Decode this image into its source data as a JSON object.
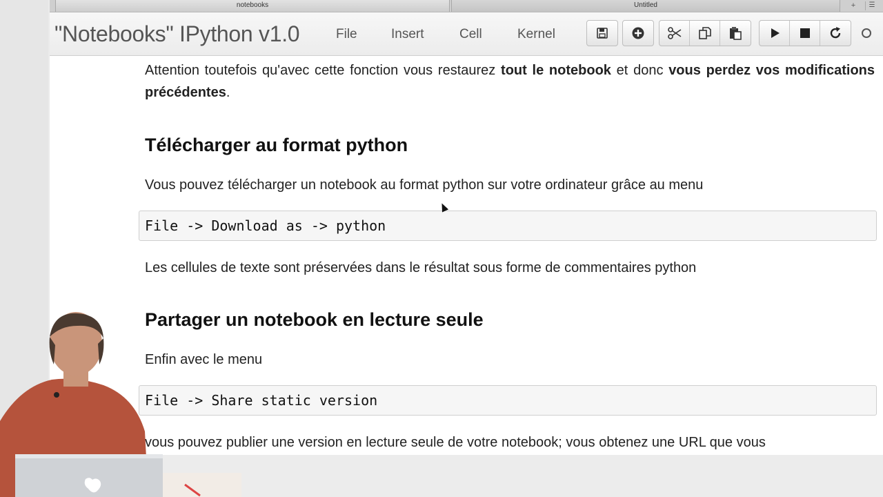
{
  "browser": {
    "tabs": [
      {
        "label": "notebooks"
      },
      {
        "label": "Untitled"
      }
    ],
    "new_tab_symbol": "+",
    "tab_list_symbol": "☰"
  },
  "header": {
    "title": "\"Notebooks\" IPython v1.0",
    "menu": [
      {
        "label": "File"
      },
      {
        "label": "Insert"
      },
      {
        "label": "Cell"
      },
      {
        "label": "Kernel"
      }
    ]
  },
  "toolbar": {
    "icons": [
      "save-icon",
      "insert-cell-icon",
      "cut-icon",
      "copy-icon",
      "paste-icon",
      "run-icon",
      "stop-icon",
      "restart-icon"
    ]
  },
  "notebook": {
    "p1_part1": "Attention toutefois qu'avec cette fonction vous restaurez ",
    "p1_bold1": "tout le notebook",
    "p1_part2": " et donc ",
    "p1_bold2": "vous perdez vos modifications précédentes",
    "p1_end": ".",
    "h_download": "Télécharger au format python",
    "p_download": "Vous pouvez télécharger un notebook au format python sur votre ordinateur grâce au menu",
    "code_download": "File -> Download as -> python",
    "p_comments": "Les cellules de texte sont préservées dans le résultat sous forme de commentaires python",
    "h_share": "Partager un notebook en lecture seule",
    "p_share": "Enfin avec le menu",
    "code_share": "File -> Share static version",
    "p_publish": "vous pouvez publier une version en lecture seule de votre notebook; vous obtenez une URL que vous"
  },
  "colors": {
    "accent": "#555555",
    "code_bg": "#f6f6f6",
    "shirt": "#b5533c"
  }
}
